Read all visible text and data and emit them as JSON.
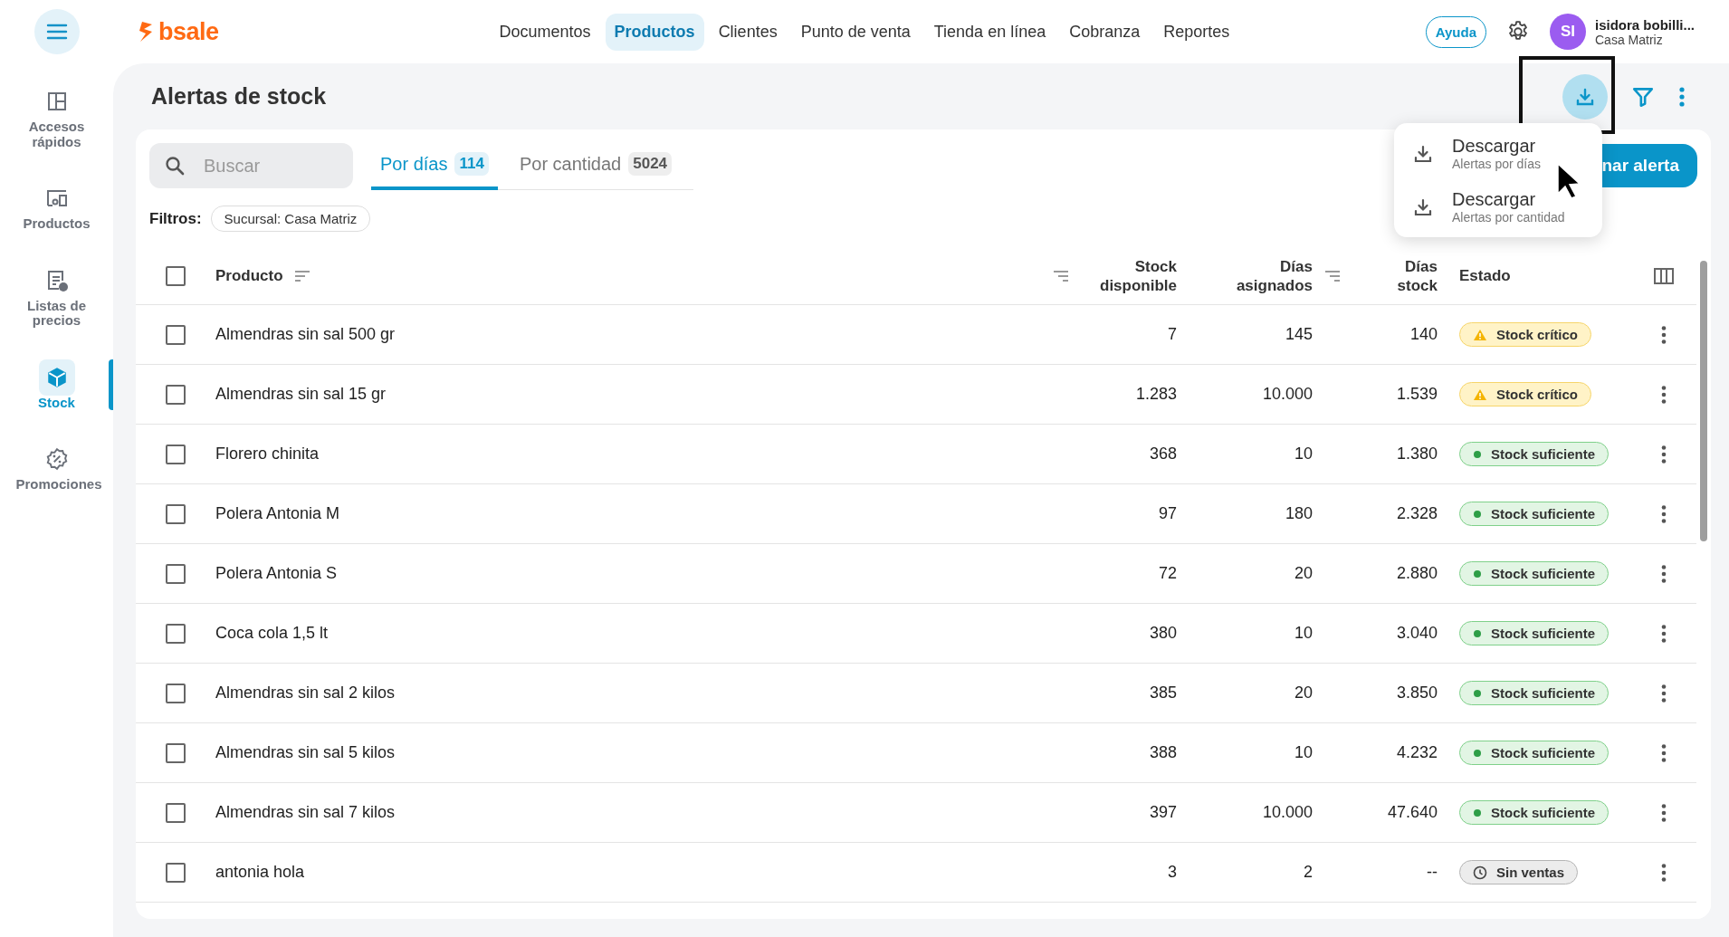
{
  "topbar": {
    "logo": "bsale",
    "nav": [
      {
        "label": "Documentos",
        "selected": false
      },
      {
        "label": "Productos",
        "selected": true
      },
      {
        "label": "Clientes",
        "selected": false
      },
      {
        "label": "Punto de venta",
        "selected": false
      },
      {
        "label": "Tienda en línea",
        "selected": false
      },
      {
        "label": "Cobranza",
        "selected": false
      },
      {
        "label": "Reportes",
        "selected": false
      }
    ],
    "help": "Ayuda",
    "user": {
      "initials": "SI",
      "name": "isidora bobilli...",
      "branch": "Casa Matriz"
    }
  },
  "sidebar": {
    "items": [
      {
        "kind": "quick",
        "label": "Accesos rápidos",
        "selected": false
      },
      {
        "kind": "products",
        "label": "Productos",
        "selected": false
      },
      {
        "kind": "prices",
        "label": "Listas de precios",
        "selected": false
      },
      {
        "kind": "stock",
        "label": "Stock",
        "selected": true
      },
      {
        "kind": "promo",
        "label": "Promociones",
        "selected": false
      }
    ]
  },
  "page": {
    "title": "Alertas de stock",
    "add_button": "nar alerta"
  },
  "search": {
    "placeholder": "Buscar"
  },
  "tabs": [
    {
      "label": "Por días",
      "count": "114",
      "selected": true
    },
    {
      "label": "Por cantidad",
      "count": "5024",
      "selected": false
    }
  ],
  "filters": {
    "label": "Filtros:",
    "chips": [
      "Sucursal: Casa Matriz"
    ]
  },
  "download_menu": {
    "items": [
      {
        "title": "Descargar",
        "subtitle": "Alertas por días"
      },
      {
        "title": "Descargar",
        "subtitle": "Alertas por cantidad"
      }
    ]
  },
  "table": {
    "select_all": false,
    "columns": [
      "Producto",
      "Stock disponible",
      "Días asignados",
      "Días stock",
      "Estado"
    ],
    "rows": [
      {
        "product": "Almendras sin sal 500 gr",
        "stock": "7",
        "assigned": "145",
        "days": "140",
        "status": {
          "kind": "critical",
          "label": "Stock crítico"
        },
        "checked": false
      },
      {
        "product": "Almendras sin sal 15 gr",
        "stock": "1.283",
        "assigned": "10.000",
        "days": "1.539",
        "status": {
          "kind": "critical",
          "label": "Stock crítico"
        },
        "checked": false
      },
      {
        "product": "Florero chinita",
        "stock": "368",
        "assigned": "10",
        "days": "1.380",
        "status": {
          "kind": "ok",
          "label": "Stock suficiente"
        },
        "checked": false
      },
      {
        "product": "Polera Antonia M",
        "stock": "97",
        "assigned": "180",
        "days": "2.328",
        "status": {
          "kind": "ok",
          "label": "Stock suficiente"
        },
        "checked": false
      },
      {
        "product": "Polera Antonia S",
        "stock": "72",
        "assigned": "20",
        "days": "2.880",
        "status": {
          "kind": "ok",
          "label": "Stock suficiente"
        },
        "checked": false
      },
      {
        "product": "Coca cola 1,5 lt",
        "stock": "380",
        "assigned": "10",
        "days": "3.040",
        "status": {
          "kind": "ok",
          "label": "Stock suficiente"
        },
        "checked": false
      },
      {
        "product": "Almendras sin sal 2 kilos",
        "stock": "385",
        "assigned": "20",
        "days": "3.850",
        "status": {
          "kind": "ok",
          "label": "Stock suficiente"
        },
        "checked": false
      },
      {
        "product": "Almendras sin sal 5 kilos",
        "stock": "388",
        "assigned": "10",
        "days": "4.232",
        "status": {
          "kind": "ok",
          "label": "Stock suficiente"
        },
        "checked": false
      },
      {
        "product": "Almendras sin sal 7 kilos",
        "stock": "397",
        "assigned": "10.000",
        "days": "47.640",
        "status": {
          "kind": "ok",
          "label": "Stock suficiente"
        },
        "checked": false
      },
      {
        "product": "antonia hola",
        "stock": "3",
        "assigned": "2",
        "days": "--",
        "status": {
          "kind": "nosales",
          "label": "Sin ventas"
        },
        "checked": false
      }
    ]
  }
}
